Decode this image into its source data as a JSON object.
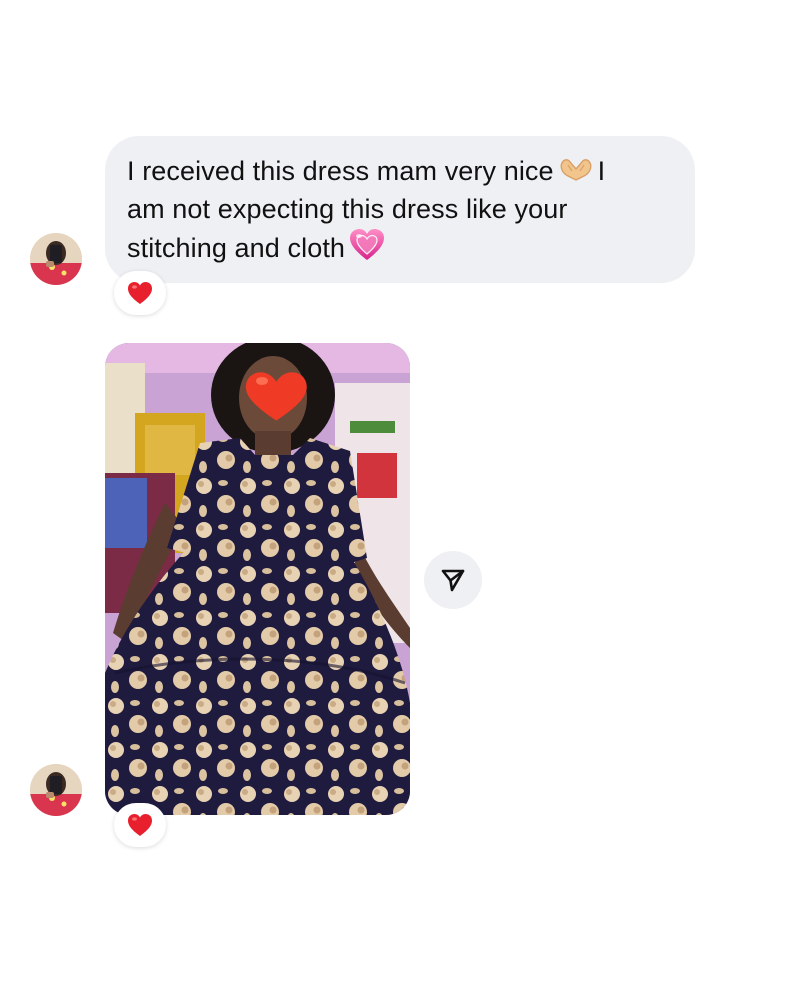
{
  "message": {
    "line1_text": "I received this dress mam very nice",
    "line1_tail": "I",
    "line2_text": "am not expecting this dress like your",
    "line3_text": "stitching and cloth",
    "emoji_1": "heart-hands-emoji",
    "emoji_2": "pink-heart-emoji",
    "reaction": "red-heart"
  },
  "photo_message": {
    "content": "photo of a person in a navy floral tiered dress",
    "reaction": "red-heart"
  },
  "colors": {
    "bubble_bg": "#eef0f3",
    "heart_red": "#e8202e",
    "pink_heart": "#e0469c",
    "background": "#ffffff"
  },
  "icons": {
    "share": "send-paper-plane-icon",
    "avatar": "user-avatar"
  }
}
